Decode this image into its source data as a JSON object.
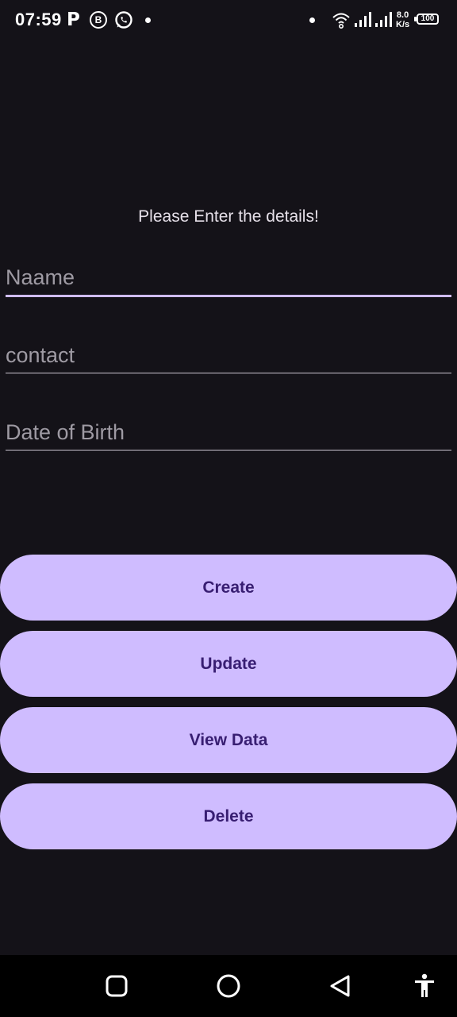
{
  "status_bar": {
    "time": "07:59",
    "speed_value": "8.0",
    "speed_unit": "K/s",
    "battery": "100"
  },
  "form": {
    "heading": "Please Enter the details!",
    "name_placeholder": "Naame",
    "contact_placeholder": "contact",
    "dob_placeholder": "Date of Birth"
  },
  "buttons": {
    "create": "Create",
    "update": "Update",
    "view_data": "View Data",
    "delete": "Delete"
  },
  "colors": {
    "background": "#141218",
    "button_bg": "#cfbcff",
    "button_text": "#381e72",
    "focused_underline": "#cfbcff"
  },
  "icons": {
    "status": [
      "p-icon",
      "b-icon",
      "whatsapp-icon",
      "dot-icon",
      "wifi-icon",
      "signal-icon",
      "battery-icon"
    ],
    "nav": [
      "recents-icon",
      "home-icon",
      "back-icon",
      "accessibility-icon"
    ]
  }
}
